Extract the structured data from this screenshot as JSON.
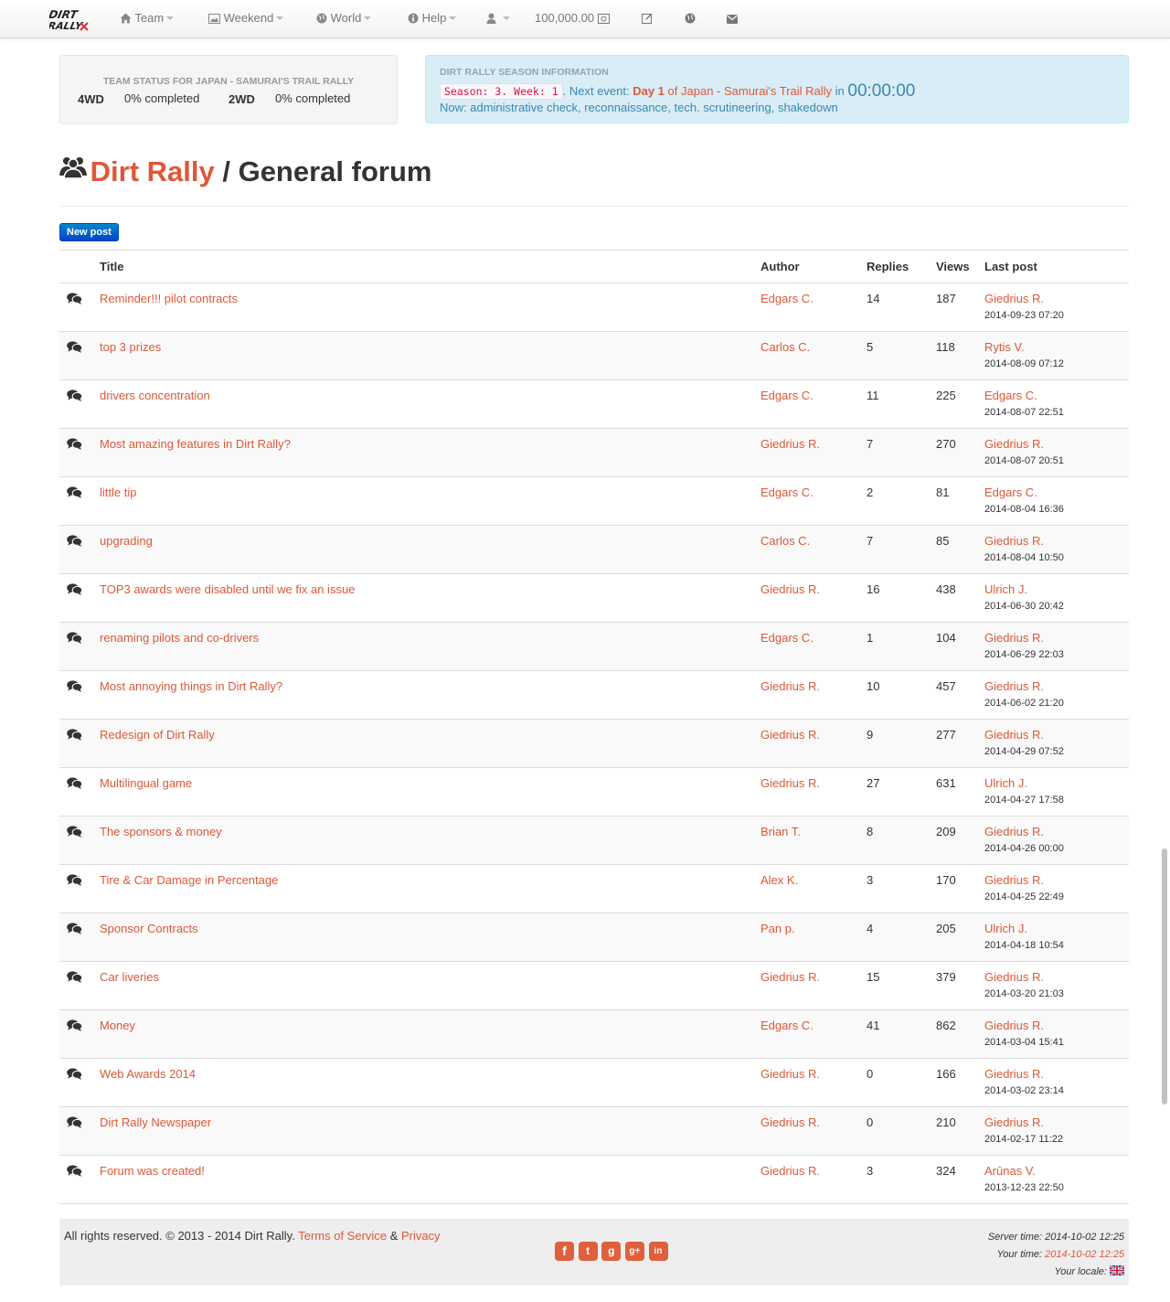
{
  "nav": {
    "items": [
      {
        "label": "Team",
        "icon": "home-icon"
      },
      {
        "label": "Weekend",
        "icon": "picture-icon"
      },
      {
        "label": "World",
        "icon": "globe-icon"
      },
      {
        "label": "Help",
        "icon": "info-icon"
      },
      {
        "label": "",
        "icon": "user-icon"
      }
    ],
    "balance": "100,000.00",
    "colors": {
      "background": "#f8f8f8",
      "text": "#777777"
    }
  },
  "team_status": {
    "heading": "TEAM STATUS FOR JAPAN - SAMURAI'S TRAIL RALLY",
    "items": [
      {
        "label": "4WD",
        "value": "0% completed"
      },
      {
        "label": "2WD",
        "value": "0% completed"
      }
    ]
  },
  "season": {
    "heading": "DIRT RALLY SEASON INFORMATION",
    "code": "Season: 3. Week: 1",
    "next_event_prefix": ". Next event: ",
    "day": "Day 1",
    "of_text": " of ",
    "event_name": "Japan - Samurai's Trail Rally",
    "in_text": " in ",
    "countdown": "00:00:00",
    "now": "Now: administrative check, reconnaissance, tech. scrutineering, shakedown"
  },
  "page": {
    "brand_link": "Dirt Rally",
    "separator": " / ",
    "title": "General forum",
    "new_post": "New post"
  },
  "table": {
    "headers": {
      "title": "Title",
      "author": "Author",
      "replies": "Replies",
      "views": "Views",
      "last_post": "Last post"
    },
    "rows": [
      {
        "title": "Reminder!!! pilot contracts",
        "author": "Edgars C.",
        "replies": "14",
        "views": "187",
        "last_author": "Giedrius R.",
        "last_date": "2014-09-23 07:20"
      },
      {
        "title": "top 3 prizes",
        "author": "Carlos C.",
        "replies": "5",
        "views": "118",
        "last_author": "Rytis V.",
        "last_date": "2014-08-09 07:12"
      },
      {
        "title": "drivers concentration",
        "author": "Edgars C.",
        "replies": "11",
        "views": "225",
        "last_author": "Edgars C.",
        "last_date": "2014-08-07 22:51"
      },
      {
        "title": "Most amazing features in Dirt Rally?",
        "author": "Giedrius R.",
        "replies": "7",
        "views": "270",
        "last_author": "Giedrius R.",
        "last_date": "2014-08-07 20:51"
      },
      {
        "title": "little tip",
        "author": "Edgars C.",
        "replies": "2",
        "views": "81",
        "last_author": "Edgars C.",
        "last_date": "2014-08-04 16:36"
      },
      {
        "title": "upgrading",
        "author": "Carlos C.",
        "replies": "7",
        "views": "85",
        "last_author": "Giedrius R.",
        "last_date": "2014-08-04 10:50"
      },
      {
        "title": "TOP3 awards were disabled until we fix an issue",
        "author": "Giedrius R.",
        "replies": "16",
        "views": "438",
        "last_author": "Ulrich J.",
        "last_date": "2014-06-30 20:42"
      },
      {
        "title": "renaming pilots and co-drivers",
        "author": "Edgars C.",
        "replies": "1",
        "views": "104",
        "last_author": "Giedrius R.",
        "last_date": "2014-06-29 22:03"
      },
      {
        "title": "Most annoying things in Dirt Rally?",
        "author": "Giedrius R.",
        "replies": "10",
        "views": "457",
        "last_author": "Giedrius R.",
        "last_date": "2014-06-02 21:20"
      },
      {
        "title": "Redesign of Dirt Rally",
        "author": "Giedrius R.",
        "replies": "9",
        "views": "277",
        "last_author": "Giedrius R.",
        "last_date": "2014-04-29 07:52"
      },
      {
        "title": "Multilingual game",
        "author": "Giedrius R.",
        "replies": "27",
        "views": "631",
        "last_author": "Ulrich J.",
        "last_date": "2014-04-27 17:58"
      },
      {
        "title": "The sponsors & money",
        "author": "Brian T.",
        "replies": "8",
        "views": "209",
        "last_author": "Giedrius R.",
        "last_date": "2014-04-26 00:00"
      },
      {
        "title": "Tire & Car Damage in Percentage",
        "author": "Alex K.",
        "replies": "3",
        "views": "170",
        "last_author": "Giedrius R.",
        "last_date": "2014-04-25 22:49"
      },
      {
        "title": "Sponsor Contracts",
        "author": "Pan p.",
        "replies": "4",
        "views": "205",
        "last_author": "Ulrich J.",
        "last_date": "2014-04-18 10:54"
      },
      {
        "title": "Car liveries",
        "author": "Giedrius R.",
        "replies": "15",
        "views": "379",
        "last_author": "Giedrius R.",
        "last_date": "2014-03-20 21:03"
      },
      {
        "title": "Money",
        "author": "Edgars C.",
        "replies": "41",
        "views": "862",
        "last_author": "Giedrius R.",
        "last_date": "2014-03-04 15:41"
      },
      {
        "title": "Web Awards 2014",
        "author": "Giedrius R.",
        "replies": "0",
        "views": "166",
        "last_author": "Giedrius R.",
        "last_date": "2014-03-02 23:14"
      },
      {
        "title": "Dirt Rally Newspaper",
        "author": "Giedrius R.",
        "replies": "0",
        "views": "210",
        "last_author": "Giedrius R.",
        "last_date": "2014-02-17 11:22"
      },
      {
        "title": "Forum was created!",
        "author": "Giedrius R.",
        "replies": "3",
        "views": "324",
        "last_author": "Arūnas V.",
        "last_date": "2013-12-23 22:50"
      }
    ]
  },
  "footer": {
    "copyright": "All rights reserved. © 2013 - 2014 Dirt Rally. ",
    "terms": "Terms of Service",
    "amp": " & ",
    "privacy": "Privacy",
    "social": [
      {
        "name": "facebook-icon",
        "glyph": "f"
      },
      {
        "name": "twitter-icon",
        "glyph": "t"
      },
      {
        "name": "github-icon",
        "glyph": "g"
      },
      {
        "name": "google-plus-icon",
        "glyph": "g+"
      },
      {
        "name": "linkedin-icon",
        "glyph": "in"
      }
    ],
    "server_time_label": "Server time: ",
    "server_time": "2014-10-02 12:25",
    "your_time_label": "Your time: ",
    "your_time": "2014-10-02 12:25",
    "locale_label": "Your locale: "
  },
  "colors": {
    "accent": "#dd5838",
    "info_bg": "#d9edf7",
    "info_text": "#3a87ad",
    "button": "#0066cc"
  }
}
